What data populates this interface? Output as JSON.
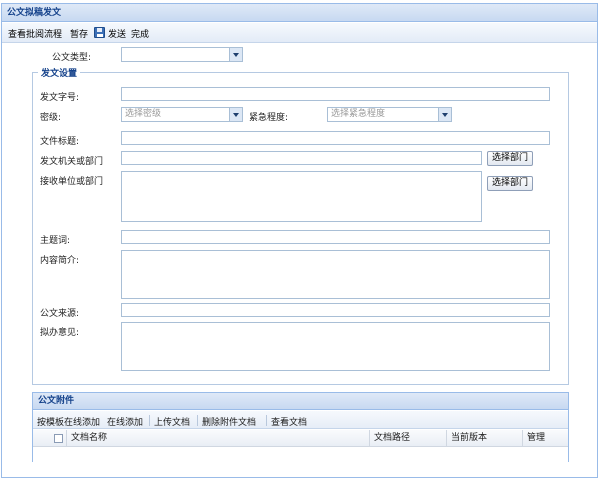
{
  "panel": {
    "title": "公文拟稿发文"
  },
  "toolbar": {
    "view_flow": "查看批阅流程",
    "save_draft": "暂存",
    "send": "发送",
    "finish": "完成"
  },
  "form": {
    "doc_type_label": "公文类型:",
    "doc_type_value": "",
    "section_title": "发文设置",
    "doc_number_label": "发文字号:",
    "secret_label": "密级:",
    "secret_placeholder": "选择密级",
    "urgency_label": "紧急程度:",
    "urgency_placeholder": "选择紧急程度",
    "title_label": "文件标题:",
    "issuing_dept_label": "发文机关或部门",
    "receiving_dept_label": "接收单位或部门",
    "select_dept_button": "选择部门",
    "keywords_label": "主题词:",
    "summary_label": "内容简介:",
    "source_label": "公文来源:",
    "opinion_label": "拟办意见:"
  },
  "attachments": {
    "title": "公文附件",
    "toolbar": {
      "template_online_add": "按模板在线添加",
      "online_add": "在线添加",
      "upload": "上传文档",
      "delete": "删除附件文档",
      "view": "查看文档"
    },
    "columns": [
      "文档名称",
      "文档路径",
      "当前版本",
      "管理"
    ]
  }
}
